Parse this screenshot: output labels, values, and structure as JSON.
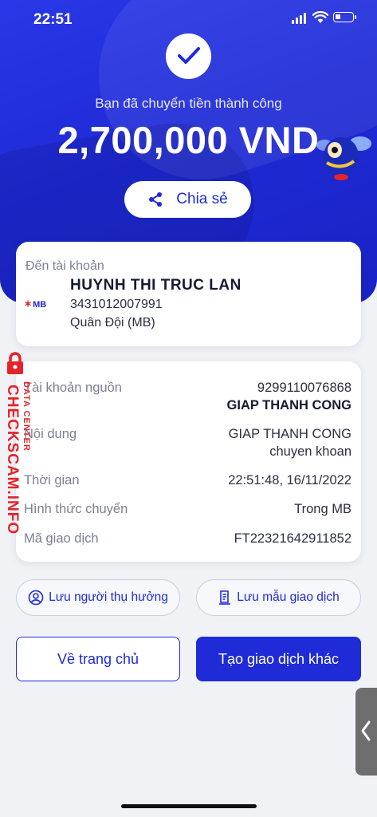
{
  "status_bar": {
    "time": "22:51"
  },
  "hero": {
    "success_text": "Bạn đã chuyển tiền thành công",
    "amount": "2,700,000 VND",
    "share_label": "Chia sẻ"
  },
  "recipient": {
    "label": "Đến tài khoản",
    "name": "HUYNH THI TRUC LAN",
    "account": "3431012007991",
    "bank": "Quân Đội (MB)",
    "bank_logo": "MB"
  },
  "details": [
    {
      "label": "Tài khoản nguồn",
      "value": "9299110076868",
      "value2": "GIAP THANH CONG"
    },
    {
      "label": "Nội dung",
      "value": "GIAP THANH CONG",
      "value2": "chuyen khoan"
    },
    {
      "label": "Thời gian",
      "value": "22:51:48, 16/11/2022"
    },
    {
      "label": "Hình thức chuyển",
      "value": "Trong MB"
    },
    {
      "label": "Mã giao dịch",
      "value": "FT22321642911852"
    }
  ],
  "actions": {
    "save_beneficiary": "Lưu người thụ hưởng",
    "save_template": "Lưu mẫu giao dịch",
    "home": "Về trang chủ",
    "new_transaction": "Tạo giao dịch khác"
  },
  "watermark": {
    "main": "CHECKSCAM.INFO",
    "sub": "DATA CENTER"
  },
  "colors": {
    "primary": "#1f2bd6",
    "brand_red": "#e3242b",
    "background": "#f1f2f6"
  }
}
